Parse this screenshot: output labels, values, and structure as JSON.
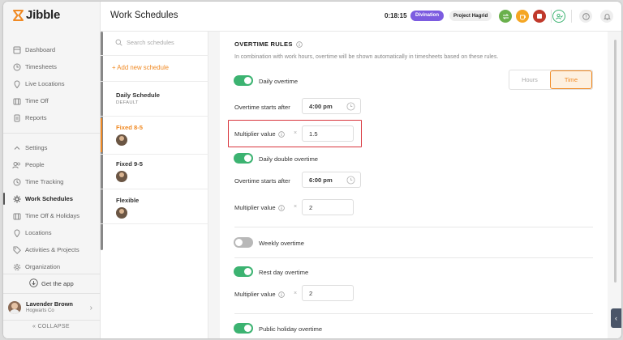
{
  "app": {
    "logo_text": "Jibble"
  },
  "sidebar": {
    "items_top": [
      {
        "label": "Dashboard",
        "icon": "dashboard-icon"
      },
      {
        "label": "Timesheets",
        "icon": "clock-icon"
      },
      {
        "label": "Live Locations",
        "icon": "location-pin-icon"
      },
      {
        "label": "Time Off",
        "icon": "calendar-icon"
      },
      {
        "label": "Reports",
        "icon": "report-icon"
      }
    ],
    "items_bottom": [
      {
        "label": "Settings",
        "icon": "chevron-up-icon"
      },
      {
        "label": "People",
        "icon": "people-icon"
      },
      {
        "label": "Time Tracking",
        "icon": "time-tracking-icon"
      },
      {
        "label": "Work Schedules",
        "icon": "work-schedules-icon",
        "active": true
      },
      {
        "label": "Time Off & Holidays",
        "icon": "calendar-icon"
      },
      {
        "label": "Locations",
        "icon": "location-pin-icon"
      },
      {
        "label": "Activities & Projects",
        "icon": "tag-icon"
      },
      {
        "label": "Organization",
        "icon": "gear-icon"
      }
    ],
    "get_app": "Get the app",
    "user": {
      "name": "Lavender Brown",
      "org": "Hogwarts Co"
    },
    "collapse": "COLLAPSE"
  },
  "header": {
    "title": "Work Schedules",
    "timer": "0:18:15",
    "activity_badge": "Divination",
    "project_badge": "Project Hagrid"
  },
  "schedules": {
    "search_placeholder": "Search schedules",
    "add_label": "+ Add new schedule",
    "items": [
      {
        "name": "Daily Schedule",
        "sub": "DEFAULT"
      },
      {
        "name": "Fixed 8-5"
      },
      {
        "name": "Fixed 9-5"
      },
      {
        "name": "Flexible"
      }
    ]
  },
  "overtime": {
    "title": "OVERTIME RULES",
    "description": "In combination with work hours, overtime will be shown automatically in timesheets based on these rules.",
    "mode_options": [
      "Hours",
      "Time"
    ],
    "mode_selected": "Time",
    "daily_overtime_label": "Daily overtime",
    "daily_overtime_on": true,
    "overtime_starts_label": "Overtime starts after",
    "daily_start": "4:00 pm",
    "multiplier_label": "Multiplier value",
    "times_sign": "×",
    "daily_multiplier": "1.5",
    "double_label": "Daily double overtime",
    "double_on": true,
    "double_start": "6:00 pm",
    "double_multiplier": "2",
    "weekly_label": "Weekly overtime",
    "weekly_on": false,
    "rest_label": "Rest day overtime",
    "rest_on": true,
    "rest_multiplier": "2",
    "holiday_label": "Public holiday overtime",
    "holiday_on": true
  },
  "colors": {
    "accent": "#f08a24",
    "toggle_on": "#3cb371",
    "badge": "#7c5ce0",
    "highlight": "#d9363e"
  }
}
